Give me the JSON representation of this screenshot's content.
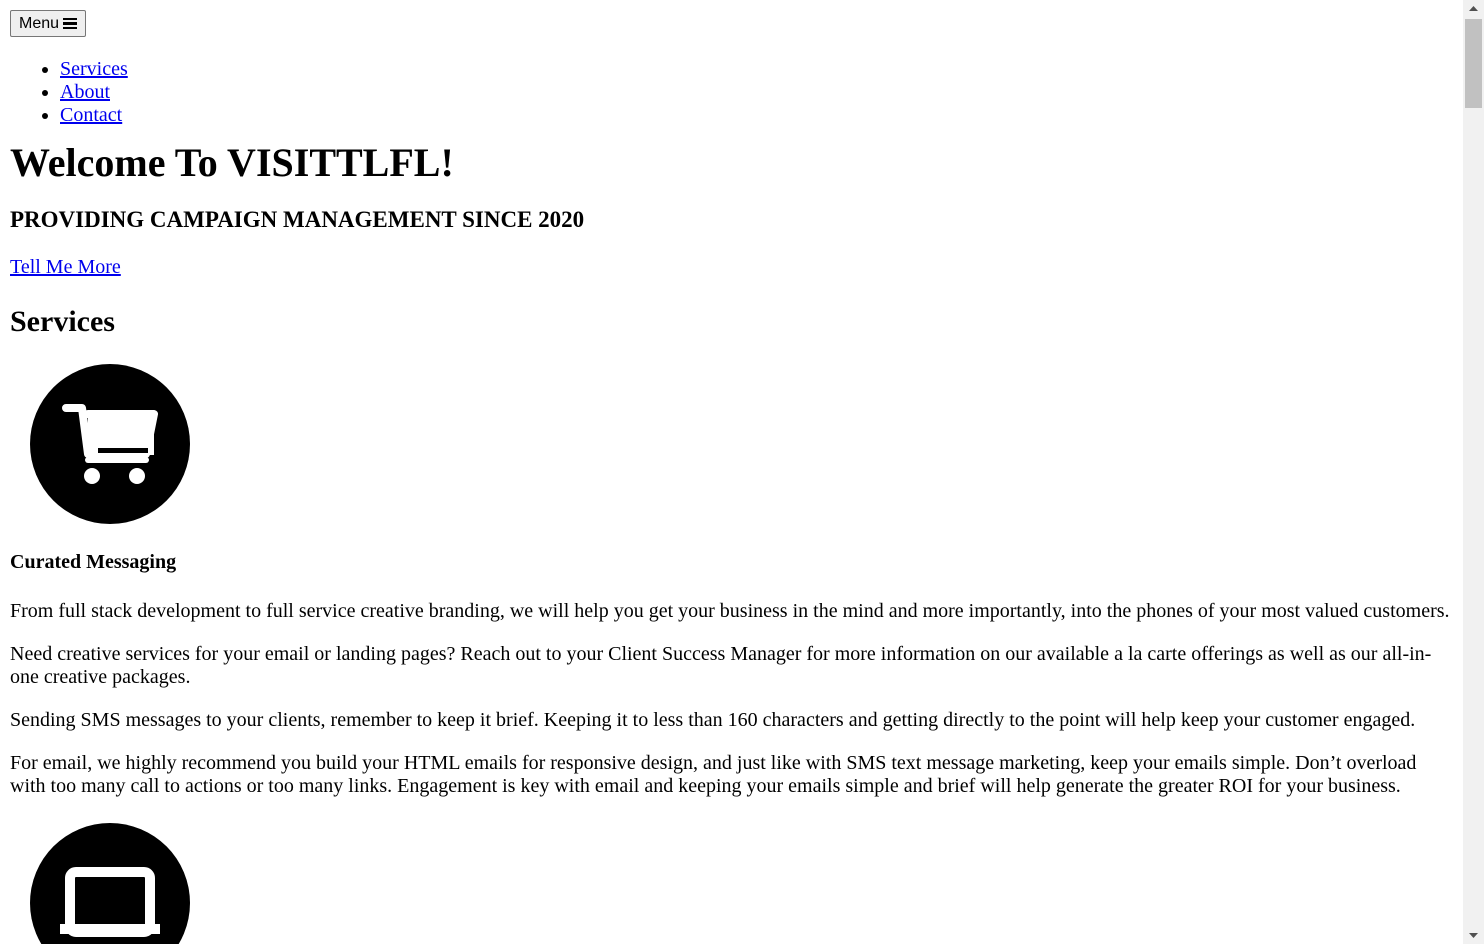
{
  "menu_button": {
    "label": "Menu",
    "icon": "hamburger-icon"
  },
  "nav": {
    "items": [
      {
        "label": "Services"
      },
      {
        "label": "About"
      },
      {
        "label": "Contact"
      }
    ]
  },
  "hero": {
    "title": "Welcome To VISITTLFL!",
    "subtitle": "PROVIDING CAMPAIGN MANAGEMENT SINCE 2020",
    "cta_label": "Tell Me More"
  },
  "services": {
    "heading": "Services",
    "items": [
      {
        "icon": "shopping-cart-icon",
        "title": "Curated Messaging",
        "paragraphs": [
          "From full stack development to full service creative branding, we will help you get your business in the mind and more importantly, into the phones of your most valued customers.",
          "Need creative services for your email or landing pages? Reach out to your Client Success Manager for more information on our available a la carte offerings as well as our all-in-one creative packages.",
          "Sending SMS messages to your clients, remember to keep it brief. Keeping it to less than 160 characters and getting directly to the point will help keep your customer engaged.",
          "For email, we highly recommend you build your HTML emails for responsive design, and just like with SMS text message marketing, keep your emails simple. Don’t overload with too many call to actions or too many links. Engagement is key with email and keeping your emails simple and brief will help generate the greater ROI for your business."
        ]
      },
      {
        "icon": "laptop-icon"
      }
    ]
  },
  "colors": {
    "link": "#0000ee",
    "icon_circle": "#000000",
    "scrollbar_track": "#f1f1f1",
    "scrollbar_thumb": "#c1c1c1"
  }
}
